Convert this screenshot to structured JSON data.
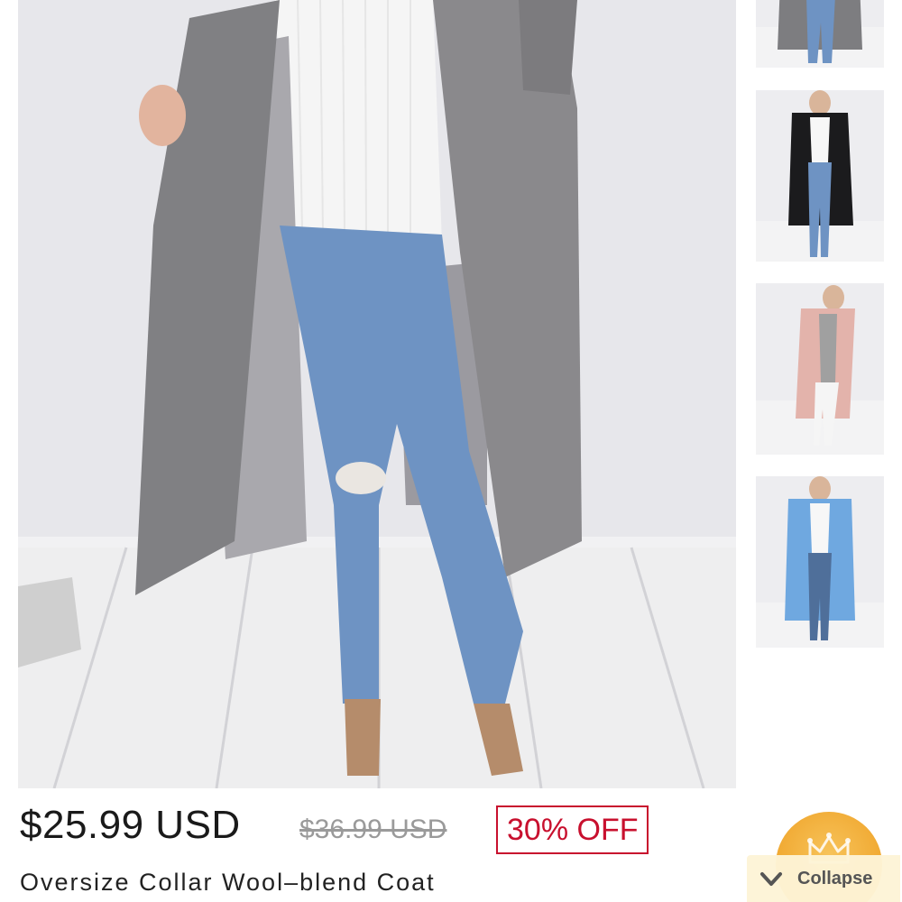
{
  "product": {
    "price": "$25.99 USD",
    "original_price": "$36.99 USD",
    "discount": "30% OFF",
    "title": "Oversize Collar Wool–blend Coat"
  },
  "gallery": {
    "main_image_icon": "coat-photo-grey",
    "thumbnails": [
      {
        "icon": "coat-photo-grey",
        "coat_color": "#7d7d80"
      },
      {
        "icon": "coat-photo-black",
        "coat_color": "#1b1b1d"
      },
      {
        "icon": "coat-photo-pink",
        "coat_color": "#e3b3ab"
      },
      {
        "icon": "coat-photo-blue",
        "coat_color": "#6fa8e0"
      }
    ]
  },
  "collapse": {
    "label": "Collapse",
    "icon": "chevron-down-icon",
    "badge_icon": "crown-icon"
  },
  "colors": {
    "discount_red": "#c8102e",
    "badge_orange": "#f0a72f"
  }
}
